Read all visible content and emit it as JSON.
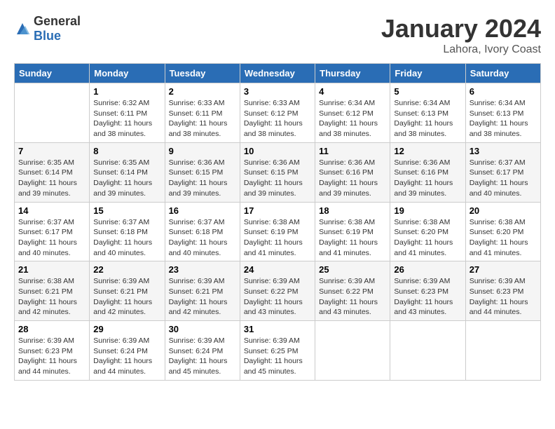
{
  "logo": {
    "general": "General",
    "blue": "Blue"
  },
  "title": "January 2024",
  "subtitle": "Lahora, Ivory Coast",
  "days_of_week": [
    "Sunday",
    "Monday",
    "Tuesday",
    "Wednesday",
    "Thursday",
    "Friday",
    "Saturday"
  ],
  "weeks": [
    [
      {
        "day": "",
        "info": ""
      },
      {
        "day": "1",
        "info": "Sunrise: 6:32 AM\nSunset: 6:11 PM\nDaylight: 11 hours and 38 minutes."
      },
      {
        "day": "2",
        "info": "Sunrise: 6:33 AM\nSunset: 6:11 PM\nDaylight: 11 hours and 38 minutes."
      },
      {
        "day": "3",
        "info": "Sunrise: 6:33 AM\nSunset: 6:12 PM\nDaylight: 11 hours and 38 minutes."
      },
      {
        "day": "4",
        "info": "Sunrise: 6:34 AM\nSunset: 6:12 PM\nDaylight: 11 hours and 38 minutes."
      },
      {
        "day": "5",
        "info": "Sunrise: 6:34 AM\nSunset: 6:13 PM\nDaylight: 11 hours and 38 minutes."
      },
      {
        "day": "6",
        "info": "Sunrise: 6:34 AM\nSunset: 6:13 PM\nDaylight: 11 hours and 38 minutes."
      }
    ],
    [
      {
        "day": "7",
        "info": "Sunrise: 6:35 AM\nSunset: 6:14 PM\nDaylight: 11 hours and 39 minutes."
      },
      {
        "day": "8",
        "info": "Sunrise: 6:35 AM\nSunset: 6:14 PM\nDaylight: 11 hours and 39 minutes."
      },
      {
        "day": "9",
        "info": "Sunrise: 6:36 AM\nSunset: 6:15 PM\nDaylight: 11 hours and 39 minutes."
      },
      {
        "day": "10",
        "info": "Sunrise: 6:36 AM\nSunset: 6:15 PM\nDaylight: 11 hours and 39 minutes."
      },
      {
        "day": "11",
        "info": "Sunrise: 6:36 AM\nSunset: 6:16 PM\nDaylight: 11 hours and 39 minutes."
      },
      {
        "day": "12",
        "info": "Sunrise: 6:36 AM\nSunset: 6:16 PM\nDaylight: 11 hours and 39 minutes."
      },
      {
        "day": "13",
        "info": "Sunrise: 6:37 AM\nSunset: 6:17 PM\nDaylight: 11 hours and 40 minutes."
      }
    ],
    [
      {
        "day": "14",
        "info": "Sunrise: 6:37 AM\nSunset: 6:17 PM\nDaylight: 11 hours and 40 minutes."
      },
      {
        "day": "15",
        "info": "Sunrise: 6:37 AM\nSunset: 6:18 PM\nDaylight: 11 hours and 40 minutes."
      },
      {
        "day": "16",
        "info": "Sunrise: 6:37 AM\nSunset: 6:18 PM\nDaylight: 11 hours and 40 minutes."
      },
      {
        "day": "17",
        "info": "Sunrise: 6:38 AM\nSunset: 6:19 PM\nDaylight: 11 hours and 41 minutes."
      },
      {
        "day": "18",
        "info": "Sunrise: 6:38 AM\nSunset: 6:19 PM\nDaylight: 11 hours and 41 minutes."
      },
      {
        "day": "19",
        "info": "Sunrise: 6:38 AM\nSunset: 6:20 PM\nDaylight: 11 hours and 41 minutes."
      },
      {
        "day": "20",
        "info": "Sunrise: 6:38 AM\nSunset: 6:20 PM\nDaylight: 11 hours and 41 minutes."
      }
    ],
    [
      {
        "day": "21",
        "info": "Sunrise: 6:38 AM\nSunset: 6:21 PM\nDaylight: 11 hours and 42 minutes."
      },
      {
        "day": "22",
        "info": "Sunrise: 6:39 AM\nSunset: 6:21 PM\nDaylight: 11 hours and 42 minutes."
      },
      {
        "day": "23",
        "info": "Sunrise: 6:39 AM\nSunset: 6:21 PM\nDaylight: 11 hours and 42 minutes."
      },
      {
        "day": "24",
        "info": "Sunrise: 6:39 AM\nSunset: 6:22 PM\nDaylight: 11 hours and 43 minutes."
      },
      {
        "day": "25",
        "info": "Sunrise: 6:39 AM\nSunset: 6:22 PM\nDaylight: 11 hours and 43 minutes."
      },
      {
        "day": "26",
        "info": "Sunrise: 6:39 AM\nSunset: 6:23 PM\nDaylight: 11 hours and 43 minutes."
      },
      {
        "day": "27",
        "info": "Sunrise: 6:39 AM\nSunset: 6:23 PM\nDaylight: 11 hours and 44 minutes."
      }
    ],
    [
      {
        "day": "28",
        "info": "Sunrise: 6:39 AM\nSunset: 6:23 PM\nDaylight: 11 hours and 44 minutes."
      },
      {
        "day": "29",
        "info": "Sunrise: 6:39 AM\nSunset: 6:24 PM\nDaylight: 11 hours and 44 minutes."
      },
      {
        "day": "30",
        "info": "Sunrise: 6:39 AM\nSunset: 6:24 PM\nDaylight: 11 hours and 45 minutes."
      },
      {
        "day": "31",
        "info": "Sunrise: 6:39 AM\nSunset: 6:25 PM\nDaylight: 11 hours and 45 minutes."
      },
      {
        "day": "",
        "info": ""
      },
      {
        "day": "",
        "info": ""
      },
      {
        "day": "",
        "info": ""
      }
    ]
  ]
}
